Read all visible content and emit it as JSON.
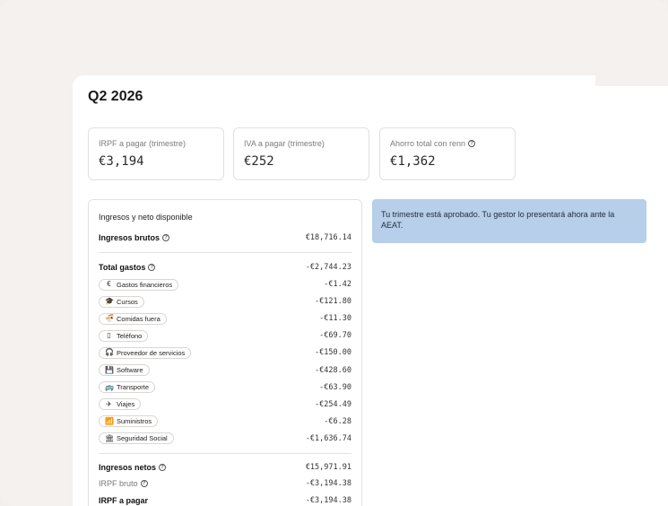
{
  "page": {
    "title": "Q2 2026"
  },
  "stats": [
    {
      "label": "IRPF a pagar (trimestre)",
      "value": "€3,194",
      "help": false
    },
    {
      "label": "IVA a pagar (trimestre)",
      "value": "€252",
      "help": false
    },
    {
      "label": "Ahorro total con renn",
      "value": "€1,362",
      "help": true
    }
  ],
  "breakdown": {
    "heading": "Ingresos y neto disponible",
    "gross": {
      "label": "Ingresos brutos",
      "value": "€18,716.14"
    },
    "expenses_total": {
      "label": "Total gastos",
      "value": "-€2,744.23"
    },
    "expenses": [
      {
        "icon": "euro-icon",
        "glyph": "€",
        "label": "Gastos financieros",
        "value": "-€1.42"
      },
      {
        "icon": "graduation-cap-icon",
        "glyph": "🎓",
        "label": "Cursos",
        "value": "-€121.80"
      },
      {
        "icon": "food-bowl-icon",
        "glyph": "🍜",
        "label": "Comidas fuera",
        "value": "-€11.30"
      },
      {
        "icon": "phone-icon",
        "glyph": "▯",
        "label": "Teléfono",
        "value": "-€69.70"
      },
      {
        "icon": "headset-icon",
        "glyph": "🎧",
        "label": "Proveedor de servicios",
        "value": "-€150.00"
      },
      {
        "icon": "save-disk-icon",
        "glyph": "💾",
        "label": "Software",
        "value": "-€428.60"
      },
      {
        "icon": "bus-icon",
        "glyph": "🚌",
        "label": "Transporte",
        "value": "-€63.90"
      },
      {
        "icon": "plane-icon",
        "glyph": "✈",
        "label": "Viajes",
        "value": "-€254.49"
      },
      {
        "icon": "wifi-icon",
        "glyph": "📶",
        "label": "Suministros",
        "value": "-€6.28"
      },
      {
        "icon": "bank-icon",
        "glyph": "🏛",
        "label": "Seguridad Social",
        "value": "-€1,636.74"
      }
    ],
    "net": {
      "label": "Ingresos netos",
      "value": "€15,971.91"
    },
    "irpf_gross": {
      "label": "IRPF bruto",
      "value": "-€3,194.38"
    },
    "irpf_pay": {
      "label": "IRPF a pagar",
      "value": "-€3,194.38"
    }
  },
  "notice": {
    "text": "Tu trimestre está aprobado. Tu gestor lo presentará ahora ante la AEAT."
  },
  "colors": {
    "notice_bg": "#b7cfe9",
    "background": "#f5f1ef"
  }
}
